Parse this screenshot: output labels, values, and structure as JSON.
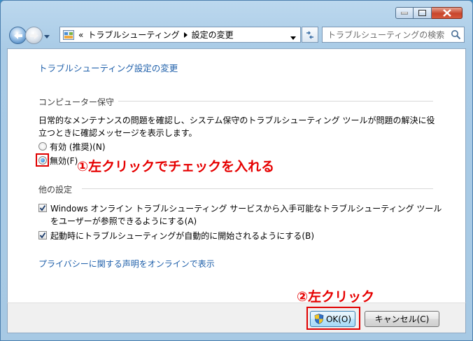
{
  "address_bar": {
    "overflow": "«",
    "crumb1": "トラブルシューティング",
    "crumb2": "設定の変更"
  },
  "search": {
    "placeholder": "トラブルシューティングの検索"
  },
  "page": {
    "title": "トラブルシューティング設定の変更",
    "section1": "コンピューター保守",
    "desc_line1": "日常的なメンテナンスの問題を確認し、システム保守のトラブルシューティング ツールが問題の解決に役",
    "desc_line2": "立つときに確認メッセージを表示します。",
    "radio_enabled": "有効 (推奨)(N)",
    "radio_disabled": "無効(F)",
    "section2": "他の設定",
    "check1_line1": "Windows オンライン トラブルシューティング サービスから入手可能なトラブルシューティング ツール",
    "check1_line2": "をユーザーが参照できるようにする(A)",
    "check2": "起動時にトラブルシューティングが自動的に開始されるようにする(B)",
    "privacy_link": "プライバシーに関する声明をオンラインで表示"
  },
  "buttons": {
    "ok": "OK(O)",
    "cancel": "キャンセル(C)"
  },
  "annotations": {
    "step1": "①左クリックでチェックを入れる",
    "step2": "②左クリック"
  },
  "state": {
    "selected_radio": "disabled",
    "check1": true,
    "check2": true
  },
  "colors": {
    "annotation": "#e60000",
    "link": "#1e5faa"
  }
}
